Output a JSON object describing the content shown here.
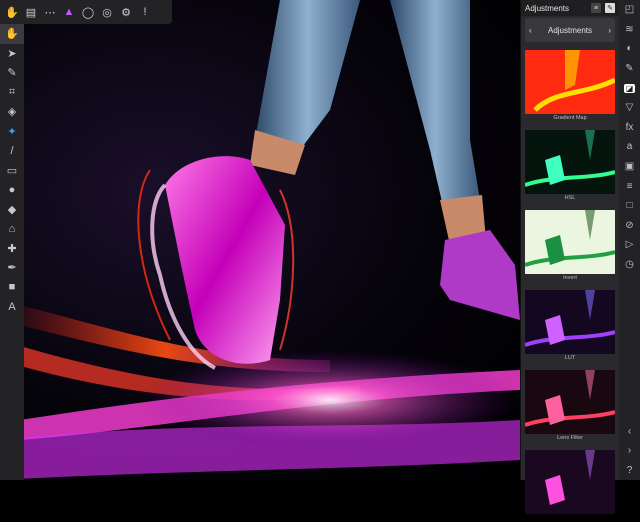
{
  "toolbar_top": {
    "items": [
      {
        "name": "hand-tool-icon",
        "glyph": "✋"
      },
      {
        "name": "document-icon",
        "glyph": "▤"
      },
      {
        "name": "more-icon",
        "glyph": "⋯"
      },
      {
        "name": "affinity-persona-icon",
        "glyph": "▲"
      },
      {
        "name": "selection-brush-icon",
        "glyph": "◯"
      },
      {
        "name": "spiral-icon",
        "glyph": "◎"
      },
      {
        "name": "settings-icon",
        "glyph": "⚙"
      },
      {
        "name": "info-icon",
        "glyph": "!"
      }
    ]
  },
  "tools": [
    {
      "name": "view-tool-icon",
      "glyph": "✋"
    },
    {
      "name": "move-tool-icon",
      "glyph": "➤"
    },
    {
      "name": "color-picker-icon",
      "glyph": "✎"
    },
    {
      "name": "crop-tool-icon",
      "glyph": "⌗"
    },
    {
      "name": "fill-tool-icon",
      "glyph": "◈"
    },
    {
      "name": "selection-brush-icon",
      "glyph": "✦"
    },
    {
      "name": "paint-brush-icon",
      "glyph": "/"
    },
    {
      "name": "eraser-icon",
      "glyph": "▭"
    },
    {
      "name": "dodge-burn-icon",
      "glyph": "●"
    },
    {
      "name": "blur-tool-icon",
      "glyph": "◆"
    },
    {
      "name": "clone-tool-icon",
      "glyph": "⌂"
    },
    {
      "name": "healing-brush-icon",
      "glyph": "✚"
    },
    {
      "name": "pen-tool-icon",
      "glyph": "✒"
    },
    {
      "name": "rectangle-tool-icon",
      "glyph": "■"
    },
    {
      "name": "text-tool-icon",
      "glyph": "A"
    }
  ],
  "panel": {
    "title": "Adjustments",
    "nav_label": "Adjustments",
    "prev": "‹",
    "next": "›",
    "thumbnails": [
      {
        "label": "Gradient Map",
        "bg": "#ff2a1a"
      },
      {
        "label": "HSL",
        "bg": "#0a2a1a"
      },
      {
        "label": "Invert",
        "bg": "#e8f5dc"
      },
      {
        "label": "LUT",
        "bg": "#1a0f2a"
      },
      {
        "label": "Lens Filter",
        "bg": "#1a0a10"
      },
      {
        "label": "",
        "bg": "#1a0a20"
      }
    ]
  },
  "studio": {
    "icons": [
      {
        "name": "navigator-icon",
        "glyph": "◰"
      },
      {
        "name": "layers-icon",
        "glyph": "≋"
      },
      {
        "name": "color-wheel-icon",
        "glyph": "◐"
      },
      {
        "name": "brushes-icon",
        "glyph": "✎"
      },
      {
        "name": "adjustments-icon",
        "glyph": "◪",
        "active": true
      },
      {
        "name": "effects-icon",
        "glyph": "▽"
      },
      {
        "name": "fx-icon",
        "glyph": "fx"
      },
      {
        "name": "text-styles-icon",
        "glyph": "a"
      },
      {
        "name": "stock-icon",
        "glyph": "▣"
      },
      {
        "name": "history-icon",
        "glyph": "≡"
      },
      {
        "name": "transform-icon",
        "glyph": "□"
      },
      {
        "name": "snapping-icon",
        "glyph": "⊘"
      },
      {
        "name": "macro-icon",
        "glyph": "▷"
      },
      {
        "name": "clock-icon",
        "glyph": "◷"
      }
    ],
    "bottom": [
      {
        "name": "back-icon",
        "glyph": "‹"
      },
      {
        "name": "forward-icon",
        "glyph": "›"
      },
      {
        "name": "help-icon",
        "glyph": "?"
      }
    ]
  },
  "colors": {
    "accent": "#c254ff",
    "panel_bg": "#2a2a2e",
    "toolbar_bg": "#232326"
  }
}
